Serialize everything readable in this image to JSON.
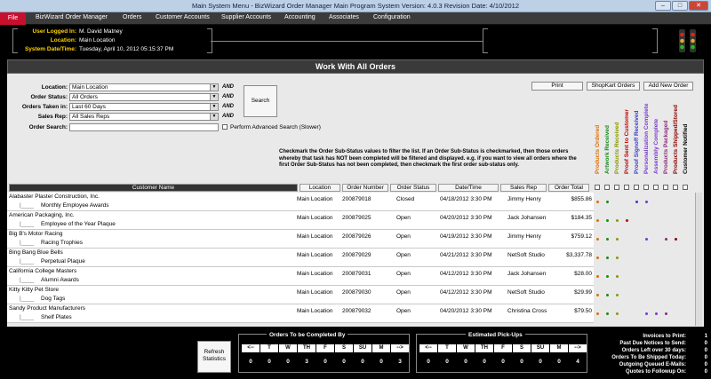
{
  "window": {
    "title": "Main System Menu - BizWizard Order Manager Main Program System  Version: 4.0.3  Revision Date: 4/10/2012",
    "minimize": "–",
    "maximize": "□",
    "close": "✕"
  },
  "menu": {
    "file": "File",
    "items": [
      "BizWizard Order Manager",
      "Orders",
      "Customer Accounts",
      "Supplier Accounts",
      "Accounting",
      "Associates",
      "Configuration"
    ]
  },
  "header": {
    "user_label": "User Logged In:",
    "user": "M. David Matney",
    "location_label": "Location:",
    "location": "Main Location",
    "datetime_label": "System Date/Time:",
    "datetime": "Tuesday, April 10, 2012   05:15:37 PM"
  },
  "page": {
    "title": "Work With All Orders"
  },
  "filters": {
    "location_label": "Location:",
    "location": "Main Location",
    "status_label": "Order Status:",
    "status": "All Orders",
    "taken_label": "Orders Taken in:",
    "taken": "Last 60 Days",
    "rep_label": "Sales Rep:",
    "rep": "All Sales Reps",
    "search_label": "Order Search:",
    "search_value": "",
    "and": "AND",
    "advanced": "Perform Advanced Search (Slower)",
    "search_button": "Search"
  },
  "actions": {
    "print": "Print",
    "shopkart": "ShopKart Orders",
    "add": "Add New Order"
  },
  "note": "Checkmark the Order Sub-Status values to filter the list.  If an Order Sub-Status is checkmarked, then those orders whereby that task has NOT been completed will be filtered and displayed.  e.g. if you want to view all orders where the first Order Sub-Status has not been completed, then checkmark the first order sub-status only.",
  "substatus": [
    {
      "label": "Products Ordered",
      "color": "#e07000"
    },
    {
      "label": "Artwork Received",
      "color": "#1a8a1a"
    },
    {
      "label": "Products Received",
      "color": "#8a9a00"
    },
    {
      "label": "Proof Sent to Customer",
      "color": "#c00000"
    },
    {
      "label": "Proof Signoff Received",
      "color": "#3a3ad0"
    },
    {
      "label": "Personalization Complete",
      "color": "#7a3ad0"
    },
    {
      "label": "Assembly Complete",
      "color": "#7a3ad0"
    },
    {
      "label": "Products Packaged",
      "color": "#8a2a7a"
    },
    {
      "label": "Products Shipped/Stored",
      "color": "#8a0000"
    },
    {
      "label": "Customer Notified",
      "color": "#000000"
    }
  ],
  "columns": {
    "customer": "Customer Name",
    "location": "Location",
    "number": "Order Number",
    "status": "Order Status",
    "datetime": "Date/Time",
    "rep": "Sales Rep",
    "total": "Order Total"
  },
  "orders": [
    {
      "customer": "Alabaster Plaster Construction, Inc.",
      "item": "Monthly Employee Awards",
      "location": "Main Location",
      "number": "200879018",
      "status": "Closed",
      "datetime": "04/18/2012 3:30 PM",
      "rep": "Jimmy Henry",
      "total": "$855.86",
      "dots": [
        1,
        1,
        0,
        0,
        1,
        1,
        0,
        0,
        0,
        0
      ]
    },
    {
      "customer": "American Packaging, Inc.",
      "item": "Employee of the Year Plaque",
      "location": "Main Location",
      "number": "200879025",
      "status": "Open",
      "datetime": "04/20/2012 3:30 PM",
      "rep": "Jack Johansen",
      "total": "$184.35",
      "dots": [
        1,
        1,
        1,
        1,
        0,
        0,
        0,
        0,
        0,
        0
      ]
    },
    {
      "customer": "Big B's Motor Racing",
      "item": "Racing Trophies",
      "location": "Main Location",
      "number": "200879026",
      "status": "Open",
      "datetime": "04/19/2012 3:30 PM",
      "rep": "Jimmy Henry",
      "total": "$759.12",
      "dots": [
        1,
        1,
        1,
        0,
        0,
        1,
        0,
        1,
        1,
        0
      ]
    },
    {
      "customer": "Bing Bang Blue Bells",
      "item": "Perpetual Plaque",
      "location": "Main Location",
      "number": "200879029",
      "status": "Open",
      "datetime": "04/21/2012 3:30 PM",
      "rep": "NetSoft Studio",
      "total": "$3,337.78",
      "dots": [
        1,
        1,
        1,
        0,
        0,
        0,
        0,
        0,
        0,
        0
      ]
    },
    {
      "customer": "California College Masters",
      "item": "Alumni Awards",
      "location": "Main Location",
      "number": "200879031",
      "status": "Open",
      "datetime": "04/12/2012 3:30 PM",
      "rep": "Jack Johansen",
      "total": "$28.00",
      "dots": [
        1,
        1,
        1,
        0,
        0,
        0,
        0,
        0,
        0,
        0
      ]
    },
    {
      "customer": "Kitty Kitty Pet Store",
      "item": "Dog Tags",
      "location": "Main Location",
      "number": "200879030",
      "status": "Open",
      "datetime": "04/12/2012 3:30 PM",
      "rep": "NetSoft Studio",
      "total": "$29.99",
      "dots": [
        1,
        1,
        1,
        0,
        0,
        0,
        0,
        0,
        0,
        0
      ]
    },
    {
      "customer": "Sandy Product Manufacturers",
      "item": "Shelf Plates",
      "location": "Main Location",
      "number": "200879032",
      "status": "Open",
      "datetime": "04/20/2012 3:30 PM",
      "rep": "Christina Cross",
      "total": "$79.50",
      "dots": [
        1,
        1,
        1,
        0,
        0,
        1,
        1,
        1,
        0,
        0
      ]
    }
  ],
  "bottom": {
    "refresh": "Refresh Statistics",
    "complete_title": "Orders To be Completed By",
    "pickup_title": "Estimated Pick-Ups",
    "days": [
      "<--",
      "T",
      "W",
      "TH",
      "F",
      "S",
      "SU",
      "M",
      "-->"
    ],
    "complete_vals": [
      "0",
      "0",
      "0",
      "3",
      "0",
      "0",
      "0",
      "0",
      "3"
    ],
    "pickup_vals": [
      "0",
      "0",
      "0",
      "0",
      "0",
      "0",
      "0",
      "0",
      "4"
    ],
    "stats": [
      {
        "label": "Invoices to Print:",
        "value": "1"
      },
      {
        "label": "Past Due Notices to Send:",
        "value": "0"
      },
      {
        "label": "Orders Left over 30 days:",
        "value": "0"
      },
      {
        "label": "Orders To Be Shipped Today:",
        "value": "0"
      },
      {
        "label": "Outgoing Queued E-Mails:",
        "value": "0"
      },
      {
        "label": "Quotes to Followup On:",
        "value": "0"
      }
    ]
  }
}
